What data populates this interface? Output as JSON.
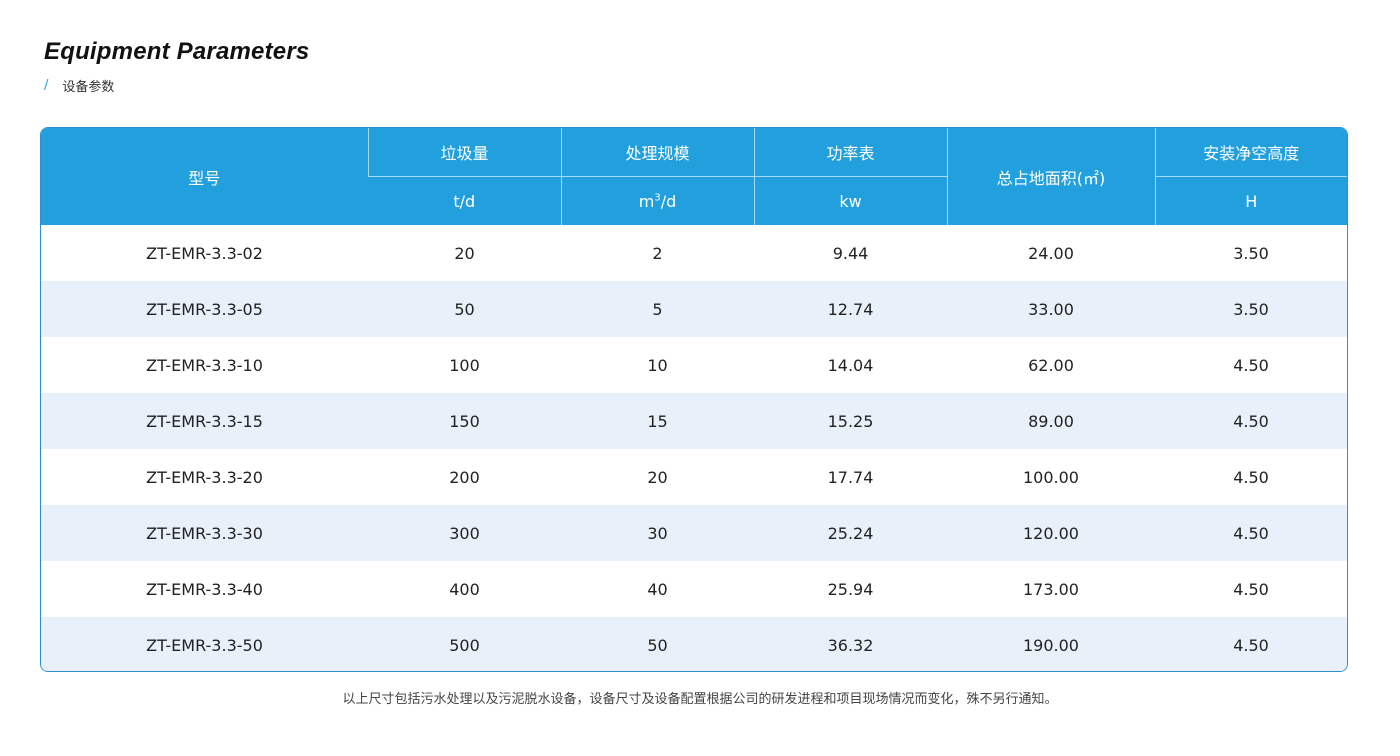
{
  "heading": {
    "title": "Equipment Parameters",
    "slash": "/",
    "subtitle": "设备参数"
  },
  "table": {
    "headers": {
      "model": "型号",
      "garbage": "垃圾量",
      "garbage_unit": "t/d",
      "scale": "处理规模",
      "scale_unit_base": "m",
      "scale_unit_sup": "3",
      "scale_unit_tail": "/d",
      "power": "功率表",
      "power_unit": "kw",
      "area": "总占地面积(㎡)",
      "height": "安装净空高度",
      "height_unit": "H"
    },
    "rows": [
      [
        "ZT-EMR-3.3-02",
        "20",
        "2",
        "9.44",
        "24.00",
        "3.50"
      ],
      [
        "ZT-EMR-3.3-05",
        "50",
        "5",
        "12.74",
        "33.00",
        "3.50"
      ],
      [
        "ZT-EMR-3.3-10",
        "100",
        "10",
        "14.04",
        "62.00",
        "4.50"
      ],
      [
        "ZT-EMR-3.3-15",
        "150",
        "15",
        "15.25",
        "89.00",
        "4.50"
      ],
      [
        "ZT-EMR-3.3-20",
        "200",
        "20",
        "17.74",
        "100.00",
        "4.50"
      ],
      [
        "ZT-EMR-3.3-30",
        "300",
        "30",
        "25.24",
        "120.00",
        "4.50"
      ],
      [
        "ZT-EMR-3.3-40",
        "400",
        "40",
        "25.94",
        "173.00",
        "4.50"
      ],
      [
        "ZT-EMR-3.3-50",
        "500",
        "50",
        "36.32",
        "190.00",
        "4.50"
      ]
    ]
  },
  "note": "以上尺寸包括污水处理以及污泥脱水设备，设备尺寸及设备配置根据公司的研发进程和项目现场情况而变化，殊不另行通知。",
  "colors": {
    "header_bg": "#22a0de",
    "stripe": "#e8f0fa",
    "accent": "#22a0de"
  }
}
